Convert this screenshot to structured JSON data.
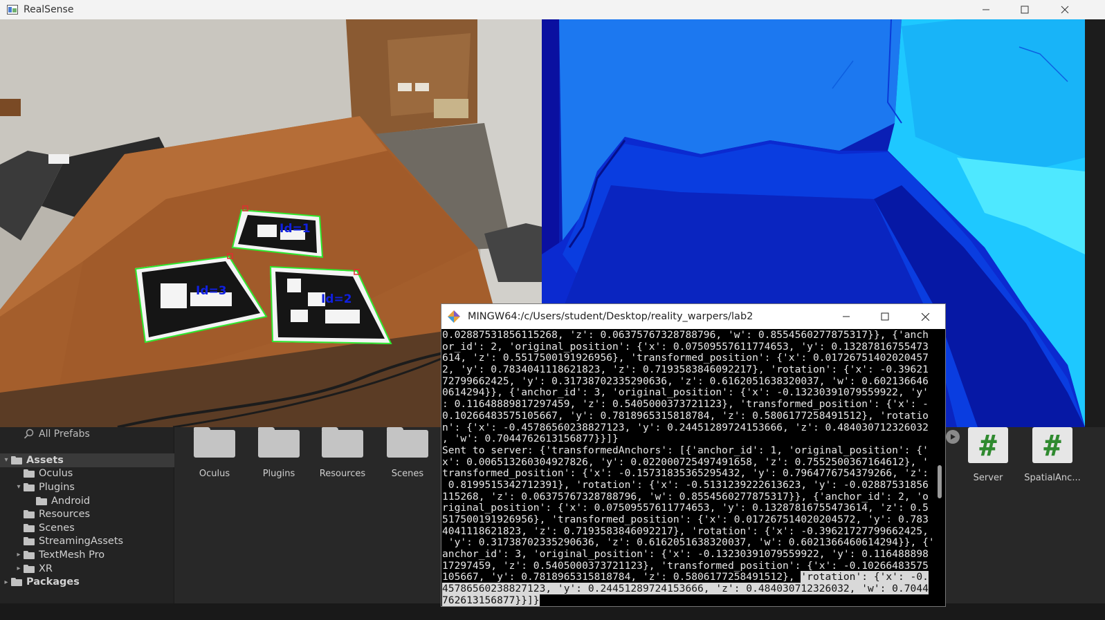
{
  "window": {
    "title": "RealSense",
    "controls": [
      "minimize-icon",
      "maximize-icon",
      "close-icon"
    ]
  },
  "color_view": {
    "markers": [
      {
        "label": "Id=1"
      },
      {
        "label": "Id=3"
      },
      {
        "label": "Id=2"
      }
    ]
  },
  "unity": {
    "search_label": "All Prefabs",
    "tree": [
      {
        "label": "Assets",
        "bold": true,
        "arrow": "▾",
        "indent": 0
      },
      {
        "label": "Oculus",
        "arrow": "",
        "indent": 1
      },
      {
        "label": "Plugins",
        "arrow": "▾",
        "indent": 1
      },
      {
        "label": "Android",
        "arrow": "",
        "indent": 2
      },
      {
        "label": "Resources",
        "arrow": "",
        "indent": 1
      },
      {
        "label": "Scenes",
        "arrow": "",
        "indent": 1
      },
      {
        "label": "StreamingAssets",
        "arrow": "",
        "indent": 1
      },
      {
        "label": "TextMesh Pro",
        "arrow": "▸",
        "indent": 1
      },
      {
        "label": "XR",
        "arrow": "▸",
        "indent": 1
      },
      {
        "label": "Packages",
        "bold": true,
        "arrow": "▸",
        "indent": 0
      }
    ],
    "folders": [
      "Oculus",
      "Plugins",
      "Resources",
      "Scenes"
    ],
    "scripts": [
      "Server",
      "SpatialAnc..."
    ]
  },
  "terminal": {
    "title": "MINGW64:/c/Users/student/Desktop/reality_warpers/lab2",
    "lines": [
      "0.02887531856115268, 'z': 0.06375767328788796, 'w': 0.8554560277875317}}, {'anch",
      "or_id': 2, 'original_position': {'x': 0.07509557611774653, 'y': 0.13287816755473",
      "614, 'z': 0.5517500191926956}, 'transformed_position': {'x': 0.01726751402020457",
      "2, 'y': 0.7834041118621823, 'z': 0.7193583846092217}, 'rotation': {'x': -0.39621",
      "72799662425, 'y': 0.31738702335290636, 'z': 0.6162051638320037, 'w': 0.602136646",
      "0614294}}, {'anchor_id': 3, 'original_position': {'x': -0.13230391079559922, 'y'",
      ": 0.11648889817297459, 'z': 0.5405000373721123}, 'transformed_position': {'x': -",
      "0.10266483575105667, 'y': 0.7818965315818784, 'z': 0.5806177258491512}, 'rotatio",
      "n': {'x': -0.45786560238827123, 'y': 0.24451289724153666, 'z': 0.484030712326032",
      ", 'w': 0.7044762613156877}}]}",
      "Sent to server: {'transformedAnchors': [{'anchor_id': 1, 'original_position': {'",
      "x': 0.006513260304927826, 'y': 0.022000725497491658, 'z': 0.7552500367164612}, '",
      "transformed_position': {'x': -0.15731835365295432, 'y': 0.7964776754379266, 'z':",
      " 0.8199515342712391}, 'rotation': {'x': -0.5131239222613623, 'y': -0.02887531856",
      "115268, 'z': 0.06375767328788796, 'w': 0.8554560277875317}}, {'anchor_id': 2, 'o",
      "riginal_position': {'x': 0.07509557611774653, 'y': 0.13287816755473614, 'z': 0.5",
      "517500191926956}, 'transformed_position': {'x': 0.017267514020204572, 'y': 0.783",
      "4041118621823, 'z': 0.7193583846092217}, 'rotation': {'x': -0.39621727799662425,",
      " 'y': 0.31738702335290636, 'z': 0.6162051638320037, 'w': 0.6021366460614294}}, {'",
      "anchor_id': 3, 'original_position': {'x': -0.13230391079559922, 'y': 0.116488898",
      "17297459, 'z': 0.5405000373721123}, 'transformed_position': {'x': -0.10266483575",
      "105667, 'y': 0.7818965315818784, 'z': 0.5806177258491512}, "
    ],
    "selected_lines": [
      "'rotation': {'x': -0.",
      "45786560238827123, 'y': 0.24451289724153666, 'z': 0.484030712326032, 'w': 0.7044",
      "762613156877}}]}"
    ]
  }
}
